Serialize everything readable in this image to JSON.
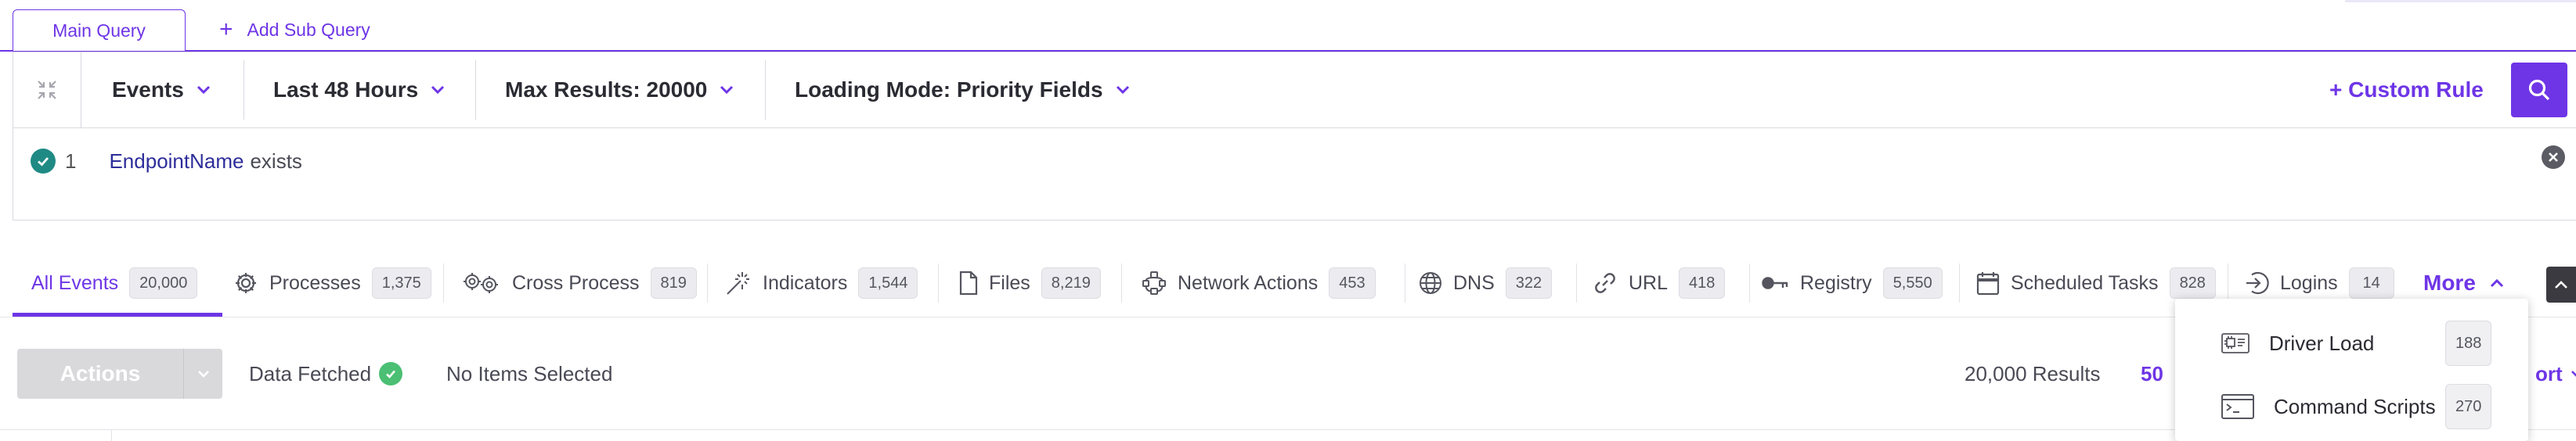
{
  "query_tabs": {
    "main": "Main Query",
    "add": "Add Sub Query"
  },
  "query_bar": {
    "dropdowns": [
      {
        "label": "Events"
      },
      {
        "label": "Last 48 Hours"
      },
      {
        "label": "Max Results: 20000"
      },
      {
        "label": "Loading Mode: Priority Fields"
      }
    ],
    "custom_rule": "+ Custom Rule"
  },
  "rule": {
    "index": "1",
    "field": "EndpointName",
    "operator": "exists"
  },
  "event_tabs": [
    {
      "label": "All Events",
      "count": "20,000",
      "icon": "none",
      "active": true
    },
    {
      "label": "Processes",
      "count": "1,375",
      "icon": "gear-icon"
    },
    {
      "label": "Cross Process",
      "count": "819",
      "icon": "double-gear-icon"
    },
    {
      "label": "Indicators",
      "count": "1,544",
      "icon": "spark-icon"
    },
    {
      "label": "Files",
      "count": "8,219",
      "icon": "file-icon"
    },
    {
      "label": "Network Actions",
      "count": "453",
      "icon": "network-icon"
    },
    {
      "label": "DNS",
      "count": "322",
      "icon": "globe-icon"
    },
    {
      "label": "URL",
      "count": "418",
      "icon": "link-icon"
    },
    {
      "label": "Registry",
      "count": "5,550",
      "icon": "key-icon"
    },
    {
      "label": "Scheduled Tasks",
      "count": "828",
      "icon": "calendar-icon"
    },
    {
      "label": "Logins",
      "count": "14",
      "icon": "login-icon"
    }
  ],
  "more_label": "More",
  "more_menu": [
    {
      "label": "Driver Load",
      "count": "188",
      "icon": "driver-icon"
    },
    {
      "label": "Command Scripts",
      "count": "270",
      "icon": "terminal-icon"
    }
  ],
  "toolbar": {
    "actions": "Actions",
    "data_fetched": "Data Fetched",
    "selection": "No Items Selected",
    "results": "20,000 Results",
    "per_page_partial": "50",
    "export_partial": "ort"
  },
  "colors": {
    "accent": "#6e35e6",
    "check_green": "#1f8a84",
    "fetched_green": "#4bbf73"
  }
}
